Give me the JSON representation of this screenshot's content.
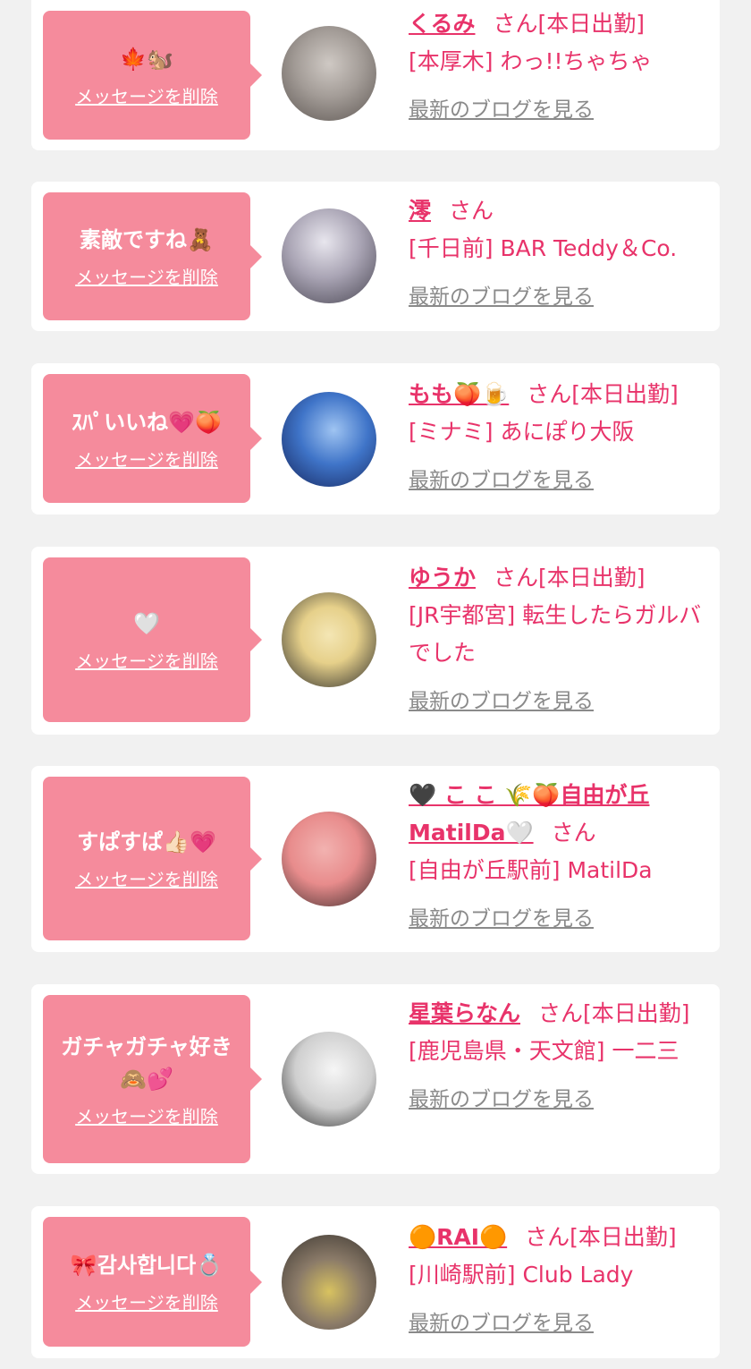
{
  "cards": [
    {
      "message": "🍁🐿️",
      "delete_label": "メッセージを削除",
      "name": "くるみ",
      "suffix": "さん[本日出勤]",
      "shop": "[本厚木] わっ!!ちゃちゃ",
      "blog_label": "最新のブログを見る",
      "avatar_colors": [
        "#cfc9c4",
        "#5e5753"
      ]
    },
    {
      "message": "素敵ですね🧸",
      "delete_label": "メッセージを削除",
      "name": "澪",
      "suffix": "さん",
      "shop": "[千日前] BAR Teddy＆Co.",
      "blog_label": "最新のブログを見る",
      "avatar_colors": [
        "#c9c5cf",
        "#494652"
      ]
    },
    {
      "message": "ｽﾊﾟいいね💗🍑",
      "delete_label": "メッセージを削除",
      "name": "もも🍑🍺",
      "suffix": "さん[本日出勤]",
      "shop": "[ミナミ] あにぽり大阪",
      "blog_label": "最新のブログを見る",
      "avatar_colors": [
        "#3f74c8",
        "#15245a"
      ]
    },
    {
      "message": "🤍",
      "delete_label": "メッセージを削除",
      "name": "ゆうか",
      "suffix": "さん[本日出勤]",
      "shop": "[JR宇都宮] 転生したらガルバでした",
      "blog_label": "最新のブログを見る",
      "avatar_colors": [
        "#e6d08a",
        "#2a2a2a"
      ]
    },
    {
      "message": "すぱすぱ👍🏻💗",
      "delete_label": "メッセージを削除",
      "name": "🖤 こ こ 🌾🍑自由が丘 MatilDa🤍",
      "suffix": "さん",
      "shop": "[自由が丘駅前] MatilDa",
      "blog_label": "最新のブログを見る",
      "avatar_colors": [
        "#e88c8c",
        "#3a2a2a"
      ]
    },
    {
      "message": "ガチャガチャ好き\n🙈💕",
      "delete_label": "メッセージを削除",
      "name": "星葉らなん",
      "suffix": "さん[本日出勤]",
      "shop": "[鹿児島県・天文館] 一二三",
      "blog_label": "最新のブログを見る",
      "avatar_colors": [
        "#eeeeee",
        "#2a2a2a"
      ]
    },
    {
      "message": "🎀감사합니다💍",
      "delete_label": "メッセージを削除",
      "name": "🟠RAI🟠",
      "suffix": "さん[本日出勤]",
      "shop": "[川崎駅前] Club Lady",
      "blog_label": "最新のブログを見る",
      "avatar_colors": [
        "#8a7a68",
        "#d8c260"
      ]
    }
  ]
}
